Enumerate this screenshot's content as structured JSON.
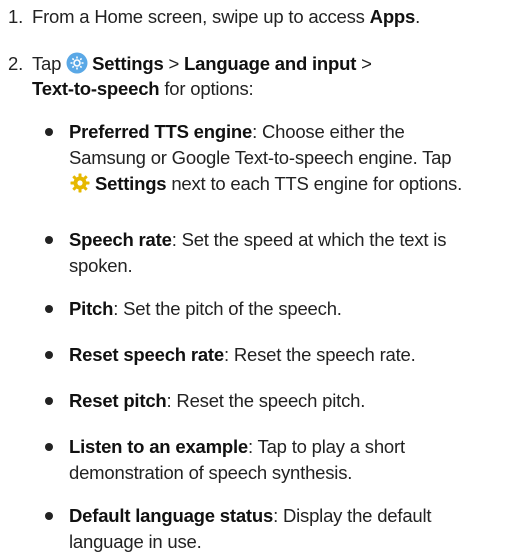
{
  "steps": [
    {
      "number": "1.",
      "pre": "From a Home screen, swipe up to access ",
      "apps": "Apps",
      "post": "."
    },
    {
      "number": "2.",
      "tap": "Tap ",
      "settings_icon": "settings-gear-icon",
      "settings": "Settings",
      "sep1": " > ",
      "language_input": "Language and input",
      "sep2": " >",
      "tts": "Text-to-speech",
      "for_options": " for options:"
    }
  ],
  "options": [
    {
      "label": "Preferred TTS engine",
      "line1": ": Choose either the",
      "line2": "Samsung or Google Text-to-speech engine. Tap",
      "icon": "gear-icon",
      "settings_label": "Settings",
      "line3_post": " next to each TTS engine for options."
    },
    {
      "label": "Speech rate",
      "line1": ": Set the speed at which the text is",
      "line2": "spoken."
    },
    {
      "label": "Pitch",
      "line1": ": Set the pitch of the speech."
    },
    {
      "label": "Reset speech rate",
      "line1": ": Reset the speech rate."
    },
    {
      "label": "Reset pitch",
      "line1": ": Reset the speech pitch."
    },
    {
      "label": "Listen to an example",
      "line1": ": Tap to play a short",
      "line2": "demonstration of speech synthesis."
    },
    {
      "label": "Default language status",
      "line1": ": Display the default",
      "line2": "language in use."
    }
  ],
  "colors": {
    "settings_icon_bg": "#5aa8e6",
    "gear_icon": "#e6b800"
  }
}
